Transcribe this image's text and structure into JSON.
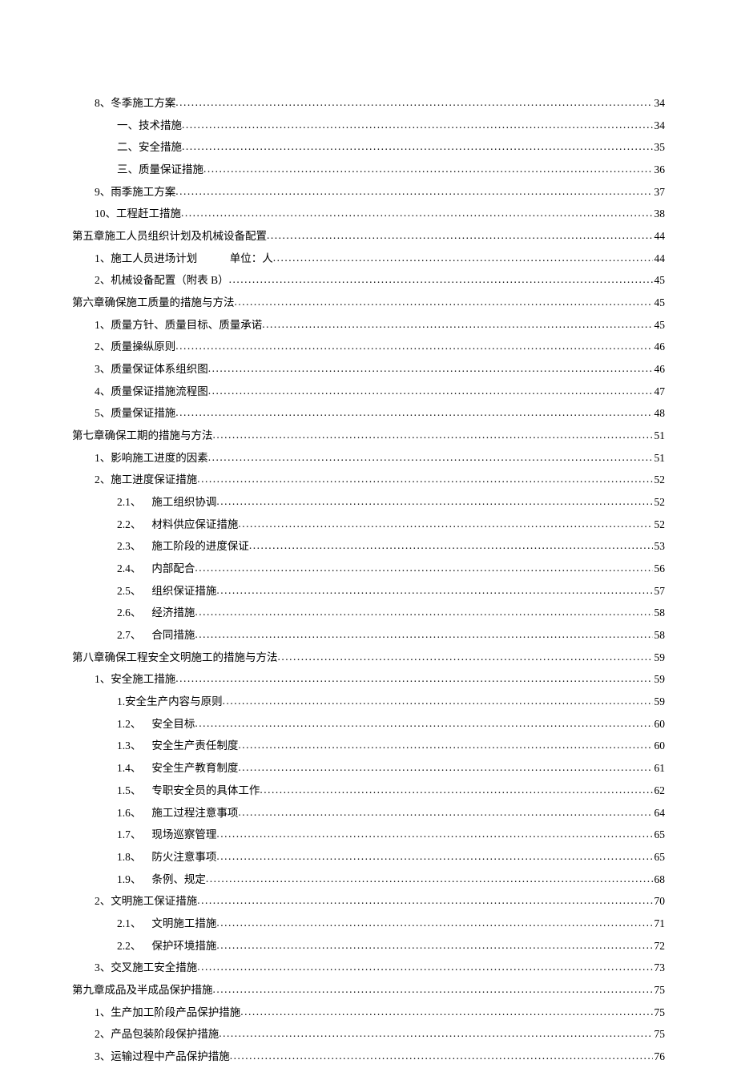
{
  "toc": [
    {
      "level": 1,
      "title": "8、冬季施工方案",
      "page": "34"
    },
    {
      "level": 2,
      "title": "一、技术措施",
      "page": "34"
    },
    {
      "level": 2,
      "title": "二、安全措施",
      "page": "35"
    },
    {
      "level": 2,
      "title": "三、质量保证措施",
      "page": "36"
    },
    {
      "level": 1,
      "title": "9、雨季施工方案",
      "page": "37"
    },
    {
      "level": 1,
      "title": "10、工程赶工措施",
      "page": "38"
    },
    {
      "level": 0,
      "title": "第五章施工人员组织计划及机械设备配置",
      "page": "44"
    },
    {
      "level": 1,
      "title": "1、施工人员进场计划　　　单位：人",
      "page": "44"
    },
    {
      "level": 1,
      "title": "2、机械设备配置（附表 B）",
      "page": "45"
    },
    {
      "level": 0,
      "title": "第六章确保施工质量的措施与方法",
      "page": "45"
    },
    {
      "level": 1,
      "title": "1、质量方针、质量目标、质量承诺",
      "page": "45"
    },
    {
      "level": 1,
      "title": "2、质量操纵原则",
      "page": "46"
    },
    {
      "level": 1,
      "title": "3、质量保证体系组织图",
      "page": "46"
    },
    {
      "level": 1,
      "title": "4、质量保证措施流程图",
      "page": "47"
    },
    {
      "level": 1,
      "title": "5、质量保证措施",
      "page": "48"
    },
    {
      "level": 0,
      "title": "第七章确保工期的措施与方法",
      "page": "51"
    },
    {
      "level": 1,
      "title": "1、影响施工进度的因素",
      "page": "51"
    },
    {
      "level": 1,
      "title": "2、施工进度保证措施",
      "page": "52"
    },
    {
      "level": 2,
      "prefix": "2.1、",
      "title": "施工组织协调",
      "page": "52"
    },
    {
      "level": 2,
      "prefix": "2.2、",
      "title": "材料供应保证措施",
      "page": "52"
    },
    {
      "level": 2,
      "prefix": "2.3、",
      "title": "施工阶段的进度保证",
      "page": "53"
    },
    {
      "level": 2,
      "prefix": "2.4、",
      "title": "内部配合",
      "page": "56"
    },
    {
      "level": 2,
      "prefix": "2.5、",
      "title": "组织保证措施",
      "page": "57"
    },
    {
      "level": 2,
      "prefix": "2.6、",
      "title": "经济措施",
      "page": "58"
    },
    {
      "level": 2,
      "prefix": "2.7、",
      "title": "合同措施",
      "page": "58"
    },
    {
      "level": 0,
      "title": "第八章确保工程安全文明施工的措施与方法",
      "page": "59"
    },
    {
      "level": 1,
      "title": "1、安全施工措施",
      "page": "59"
    },
    {
      "level": 2,
      "title": "1.安全生产内容与原则",
      "page": "59"
    },
    {
      "level": 2,
      "prefix": "1.2、",
      "title": "安全目标",
      "page": "60"
    },
    {
      "level": 2,
      "prefix": "1.3、",
      "title": "安全生产责任制度",
      "page": "60"
    },
    {
      "level": 2,
      "prefix": "1.4、",
      "title": "安全生产教育制度",
      "page": "61"
    },
    {
      "level": 2,
      "prefix": "1.5、",
      "title": "专职安全员的具体工作",
      "page": "62"
    },
    {
      "level": 2,
      "prefix": "1.6、",
      "title": "施工过程注意事项",
      "page": "64"
    },
    {
      "level": 2,
      "prefix": "1.7、",
      "title": "现场巡察管理",
      "page": "65"
    },
    {
      "level": 2,
      "prefix": "1.8、",
      "title": "防火注意事项",
      "page": "65"
    },
    {
      "level": 2,
      "prefix": "1.9、",
      "title": "条例、规定",
      "page": "68"
    },
    {
      "level": 1,
      "title": "2、文明施工保证措施",
      "page": "70"
    },
    {
      "level": 2,
      "prefix": "2.1、",
      "title": "文明施工措施",
      "page": "71"
    },
    {
      "level": 2,
      "prefix": "2.2、",
      "title": "保护环境措施",
      "page": "72"
    },
    {
      "level": 1,
      "title": "3、交叉施工安全措施",
      "page": "73"
    },
    {
      "level": 0,
      "title": "第九章成品及半成品保护措施",
      "page": "75"
    },
    {
      "level": 1,
      "title": "1、生产加工阶段产品保护措施",
      "page": "75"
    },
    {
      "level": 1,
      "title": "2、产品包装阶段保护措施",
      "page": "75"
    },
    {
      "level": 1,
      "title": "3、运输过程中产品保护措施",
      "page": "76"
    }
  ]
}
